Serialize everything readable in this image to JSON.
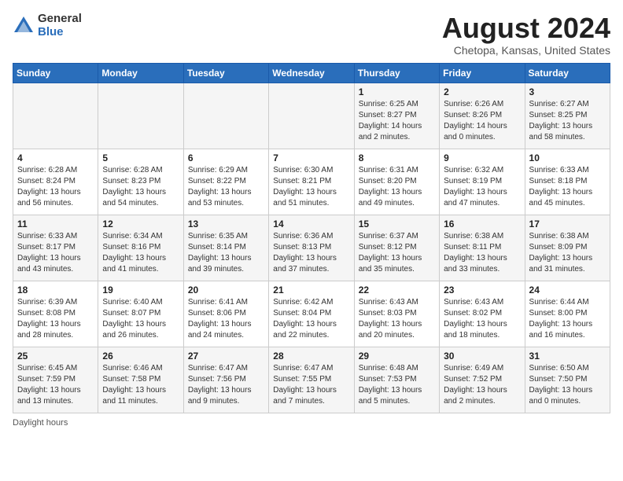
{
  "header": {
    "logo_general": "General",
    "logo_blue": "Blue",
    "month_title": "August 2024",
    "location": "Chetopa, Kansas, United States"
  },
  "days_of_week": [
    "Sunday",
    "Monday",
    "Tuesday",
    "Wednesday",
    "Thursday",
    "Friday",
    "Saturday"
  ],
  "weeks": [
    [
      {
        "day": "",
        "info": ""
      },
      {
        "day": "",
        "info": ""
      },
      {
        "day": "",
        "info": ""
      },
      {
        "day": "",
        "info": ""
      },
      {
        "day": "1",
        "info": "Sunrise: 6:25 AM\nSunset: 8:27 PM\nDaylight: 14 hours\nand 2 minutes."
      },
      {
        "day": "2",
        "info": "Sunrise: 6:26 AM\nSunset: 8:26 PM\nDaylight: 14 hours\nand 0 minutes."
      },
      {
        "day": "3",
        "info": "Sunrise: 6:27 AM\nSunset: 8:25 PM\nDaylight: 13 hours\nand 58 minutes."
      }
    ],
    [
      {
        "day": "4",
        "info": "Sunrise: 6:28 AM\nSunset: 8:24 PM\nDaylight: 13 hours\nand 56 minutes."
      },
      {
        "day": "5",
        "info": "Sunrise: 6:28 AM\nSunset: 8:23 PM\nDaylight: 13 hours\nand 54 minutes."
      },
      {
        "day": "6",
        "info": "Sunrise: 6:29 AM\nSunset: 8:22 PM\nDaylight: 13 hours\nand 53 minutes."
      },
      {
        "day": "7",
        "info": "Sunrise: 6:30 AM\nSunset: 8:21 PM\nDaylight: 13 hours\nand 51 minutes."
      },
      {
        "day": "8",
        "info": "Sunrise: 6:31 AM\nSunset: 8:20 PM\nDaylight: 13 hours\nand 49 minutes."
      },
      {
        "day": "9",
        "info": "Sunrise: 6:32 AM\nSunset: 8:19 PM\nDaylight: 13 hours\nand 47 minutes."
      },
      {
        "day": "10",
        "info": "Sunrise: 6:33 AM\nSunset: 8:18 PM\nDaylight: 13 hours\nand 45 minutes."
      }
    ],
    [
      {
        "day": "11",
        "info": "Sunrise: 6:33 AM\nSunset: 8:17 PM\nDaylight: 13 hours\nand 43 minutes."
      },
      {
        "day": "12",
        "info": "Sunrise: 6:34 AM\nSunset: 8:16 PM\nDaylight: 13 hours\nand 41 minutes."
      },
      {
        "day": "13",
        "info": "Sunrise: 6:35 AM\nSunset: 8:14 PM\nDaylight: 13 hours\nand 39 minutes."
      },
      {
        "day": "14",
        "info": "Sunrise: 6:36 AM\nSunset: 8:13 PM\nDaylight: 13 hours\nand 37 minutes."
      },
      {
        "day": "15",
        "info": "Sunrise: 6:37 AM\nSunset: 8:12 PM\nDaylight: 13 hours\nand 35 minutes."
      },
      {
        "day": "16",
        "info": "Sunrise: 6:38 AM\nSunset: 8:11 PM\nDaylight: 13 hours\nand 33 minutes."
      },
      {
        "day": "17",
        "info": "Sunrise: 6:38 AM\nSunset: 8:09 PM\nDaylight: 13 hours\nand 31 minutes."
      }
    ],
    [
      {
        "day": "18",
        "info": "Sunrise: 6:39 AM\nSunset: 8:08 PM\nDaylight: 13 hours\nand 28 minutes."
      },
      {
        "day": "19",
        "info": "Sunrise: 6:40 AM\nSunset: 8:07 PM\nDaylight: 13 hours\nand 26 minutes."
      },
      {
        "day": "20",
        "info": "Sunrise: 6:41 AM\nSunset: 8:06 PM\nDaylight: 13 hours\nand 24 minutes."
      },
      {
        "day": "21",
        "info": "Sunrise: 6:42 AM\nSunset: 8:04 PM\nDaylight: 13 hours\nand 22 minutes."
      },
      {
        "day": "22",
        "info": "Sunrise: 6:43 AM\nSunset: 8:03 PM\nDaylight: 13 hours\nand 20 minutes."
      },
      {
        "day": "23",
        "info": "Sunrise: 6:43 AM\nSunset: 8:02 PM\nDaylight: 13 hours\nand 18 minutes."
      },
      {
        "day": "24",
        "info": "Sunrise: 6:44 AM\nSunset: 8:00 PM\nDaylight: 13 hours\nand 16 minutes."
      }
    ],
    [
      {
        "day": "25",
        "info": "Sunrise: 6:45 AM\nSunset: 7:59 PM\nDaylight: 13 hours\nand 13 minutes."
      },
      {
        "day": "26",
        "info": "Sunrise: 6:46 AM\nSunset: 7:58 PM\nDaylight: 13 hours\nand 11 minutes."
      },
      {
        "day": "27",
        "info": "Sunrise: 6:47 AM\nSunset: 7:56 PM\nDaylight: 13 hours\nand 9 minutes."
      },
      {
        "day": "28",
        "info": "Sunrise: 6:47 AM\nSunset: 7:55 PM\nDaylight: 13 hours\nand 7 minutes."
      },
      {
        "day": "29",
        "info": "Sunrise: 6:48 AM\nSunset: 7:53 PM\nDaylight: 13 hours\nand 5 minutes."
      },
      {
        "day": "30",
        "info": "Sunrise: 6:49 AM\nSunset: 7:52 PM\nDaylight: 13 hours\nand 2 minutes."
      },
      {
        "day": "31",
        "info": "Sunrise: 6:50 AM\nSunset: 7:50 PM\nDaylight: 13 hours\nand 0 minutes."
      }
    ]
  ],
  "footer": {
    "note": "Daylight hours"
  }
}
